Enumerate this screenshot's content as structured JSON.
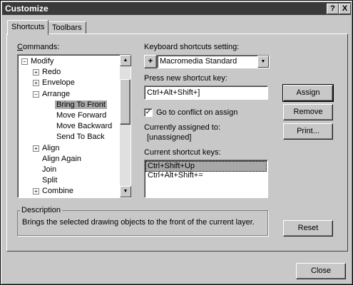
{
  "window": {
    "title": "Customize",
    "help_btn": "?",
    "close_btn": "X"
  },
  "tabs": [
    {
      "label": "Shortcuts"
    },
    {
      "label": "Toolbars"
    }
  ],
  "commands": {
    "label": "Commands:",
    "items": [
      {
        "label": "Modify",
        "expander": "−"
      },
      {
        "label": "Redo",
        "expander": "+"
      },
      {
        "label": "Envelope",
        "expander": "+"
      },
      {
        "label": "Arrange",
        "expander": "−"
      },
      {
        "label": "Bring To Front"
      },
      {
        "label": "Move Forward"
      },
      {
        "label": "Move Backward"
      },
      {
        "label": "Send To Back"
      },
      {
        "label": "Align",
        "expander": "+"
      },
      {
        "label": "Align Again"
      },
      {
        "label": "Join"
      },
      {
        "label": "Split"
      },
      {
        "label": "Combine",
        "expander": "+"
      }
    ]
  },
  "keyboard_setting": {
    "label": "Keyboard shortcuts setting:",
    "value": "Macromedia Standard",
    "plus": "+"
  },
  "new_shortcut": {
    "label": "Press new shortcut key:",
    "value": "Ctrl+Alt+Shift+]"
  },
  "conflict": {
    "label": "Go to conflict on assign",
    "checked": "✓"
  },
  "currently_assigned": {
    "label": "Currently assigned to:",
    "value": "[unassigned]"
  },
  "current_keys": {
    "label": "Current shortcut keys:",
    "items": [
      "Ctrl+Shift+Up",
      "Ctrl+Alt+Shift+="
    ]
  },
  "buttons": {
    "assign": "Assign",
    "remove": "Remove",
    "print": "Print...",
    "reset": "Reset",
    "close": "Close"
  },
  "description": {
    "label": "Description",
    "text": "Brings the selected drawing objects to the front of the current layer."
  }
}
